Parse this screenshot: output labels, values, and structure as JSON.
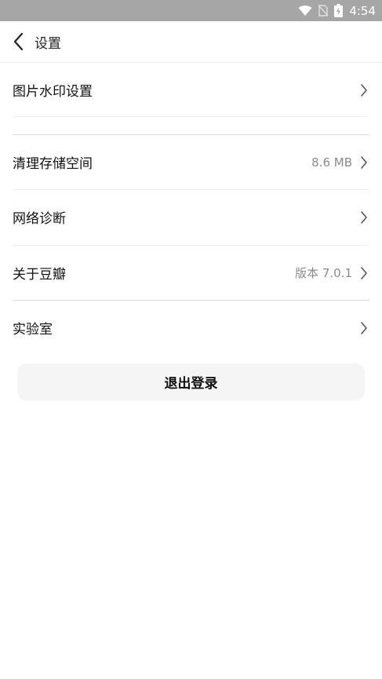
{
  "status_bar": {
    "time": "4:54"
  },
  "header": {
    "title": "设置"
  },
  "items": [
    {
      "label": "图片水印设置",
      "value": ""
    },
    {
      "label": "清理存储空间",
      "value": "8.6 MB"
    },
    {
      "label": "网络诊断",
      "value": ""
    },
    {
      "label": "关于豆瓣",
      "value": "版本 7.0.1"
    },
    {
      "label": "实验室",
      "value": ""
    }
  ],
  "logout": {
    "label": "退出登录"
  },
  "colors": {
    "status_bar": "#a6a6a6",
    "button_bg": "#f5f5f5",
    "secondary_text": "#8a8a8a"
  }
}
